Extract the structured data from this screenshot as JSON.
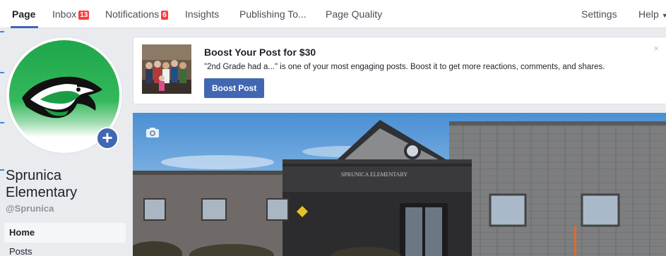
{
  "nav": {
    "tabs": [
      {
        "label": "Page"
      },
      {
        "label": "Inbox",
        "badge": "13"
      },
      {
        "label": "Notifications",
        "badge": "6"
      },
      {
        "label": "Insights"
      },
      {
        "label": "Publishing To..."
      },
      {
        "label": "Page Quality"
      }
    ],
    "settings": "Settings",
    "help": "Help"
  },
  "profile": {
    "name": "Sprunica Elementary",
    "handle": "@Sprunica"
  },
  "sidebar": {
    "items": [
      {
        "label": "Home"
      },
      {
        "label": "Posts"
      }
    ]
  },
  "boost": {
    "title": "Boost Your Post for $30",
    "description": "\"2nd Grade had a...\" is one of your most engaging posts. Boost it to get more reactions, comments, and shares.",
    "button": "Boost Post",
    "close": "×"
  },
  "cover": {
    "sign_text": "SPRUNICA ELEMENTARY"
  },
  "colors": {
    "accent": "#4267b2",
    "badge": "#fa3e3e",
    "page_bg": "#e9ebee"
  },
  "icons": {
    "add": "plus-icon",
    "camera": "camera-icon",
    "close": "close-icon",
    "help_caret": "caret-down-icon"
  }
}
